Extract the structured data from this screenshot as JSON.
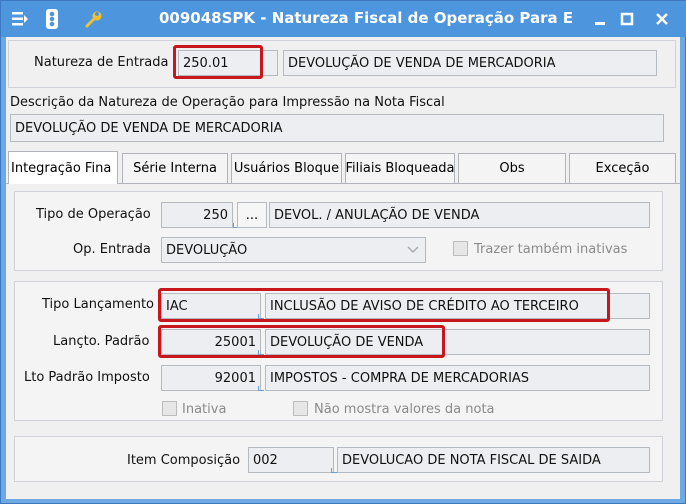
{
  "window": {
    "title": "009048SPK - Natureza Fiscal de Operação Para E",
    "icons": [
      "menu-icon",
      "traffic-light-icon",
      "wrench-icon"
    ],
    "controls": [
      "minimize-icon",
      "maximize-icon",
      "close-icon"
    ]
  },
  "header": {
    "natureza_label": "Natureza de Entrada",
    "natureza_code": "250.01",
    "natureza_desc": "DEVOLUÇÃO DE VENDA DE MERCADORIA",
    "descricao_label": "Descrição da Natureza de Operação para Impressão na Nota Fiscal",
    "descricao_value": "DEVOLUÇÃO DE VENDA DE MERCADORIA"
  },
  "tabs": [
    {
      "label": "Integração Fina",
      "active": true
    },
    {
      "label": "Série Interna"
    },
    {
      "label": "Usuários Bloque"
    },
    {
      "label": "Filiais Bloqueada"
    },
    {
      "label": "Obs"
    },
    {
      "label": "Exceção"
    }
  ],
  "operacao": {
    "tipo_label": "Tipo de Operação",
    "tipo_code": "250",
    "tipo_button": "...",
    "tipo_desc": "DEVOL. / ANULAÇÃO DE VENDA",
    "op_entrada_label": "Op. Entrada",
    "op_entrada_value": "DEVOLUÇÃO",
    "trazer_inativas_label": "Trazer também inativas"
  },
  "lancamento": {
    "tipo_label": "Tipo Lançamento",
    "tipo_code": "IAC",
    "tipo_desc": "INCLUSÃO DE AVISO DE CRÉDITO AO TERCEIRO",
    "padrao_label": "Lançto. Padrão",
    "padrao_code": "25001",
    "padrao_desc": "DEVOLUÇÃO DE VENDA",
    "imposto_label": "Lto Padrão Imposto",
    "imposto_code": "92001",
    "imposto_desc": "IMPOSTOS - COMPRA DE MERCADORIAS",
    "inativa_label": "Inativa",
    "nao_mostra_label": "Não mostra valores da nota"
  },
  "composicao": {
    "label": "Item Composição",
    "code": "002",
    "desc": "DEVOLUCAO DE NOTA FISCAL DE SAIDA"
  },
  "colors": {
    "titlebar": "#4d95dd",
    "highlight": "#c8171c"
  }
}
